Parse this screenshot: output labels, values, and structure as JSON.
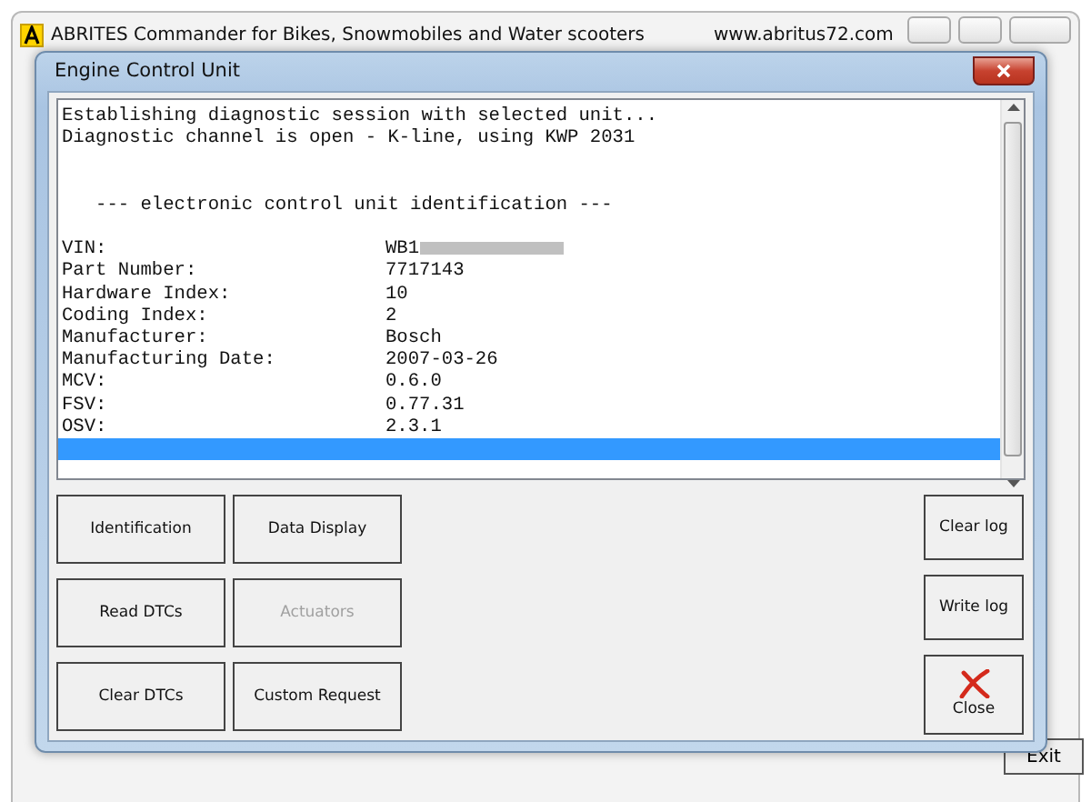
{
  "window": {
    "title": "ABRITES Commander for Bikes, Snowmobiles and Water scooters",
    "website": "www.abritus72.com",
    "background_button": "Exit"
  },
  "dialog": {
    "title": "Engine Control Unit"
  },
  "log": {
    "status_lines": [
      "Establishing diagnostic session with selected unit...",
      "Diagnostic channel is open - K-line, using KWP 2031"
    ],
    "heading": "   --- electronic control unit identification ---",
    "fields": [
      {
        "label": "VIN:",
        "value": "WB1",
        "redacted": true
      },
      {
        "label": "Part Number:",
        "value": "7717143",
        "redacted": false
      },
      {
        "label": "Hardware Index:",
        "value": "10",
        "redacted": false
      },
      {
        "label": "Coding Index:",
        "value": "2",
        "redacted": false
      },
      {
        "label": "Manufacturer:",
        "value": "Bosch",
        "redacted": false
      },
      {
        "label": "Manufacturing Date:",
        "value": "2007-03-26",
        "redacted": false
      },
      {
        "label": "MCV:",
        "value": "0.6.0",
        "redacted": false
      },
      {
        "label": "FSV:",
        "value": "0.77.31",
        "redacted": false
      },
      {
        "label": "OSV:",
        "value": "2.3.1",
        "redacted": false
      }
    ],
    "blank_row_selected": true
  },
  "function_buttons": [
    {
      "label": "Identification",
      "disabled": false
    },
    {
      "label": "Data Display",
      "disabled": false
    },
    {
      "label": "Read DTCs",
      "disabled": false
    },
    {
      "label": "Actuators",
      "disabled": true
    },
    {
      "label": "Clear DTCs",
      "disabled": false
    },
    {
      "label": "Custom Request",
      "disabled": false
    }
  ],
  "side_buttons": [
    {
      "label": "Clear log",
      "kind": "text"
    },
    {
      "label": "Write log",
      "kind": "text"
    },
    {
      "label": "Close",
      "kind": "close"
    }
  ]
}
